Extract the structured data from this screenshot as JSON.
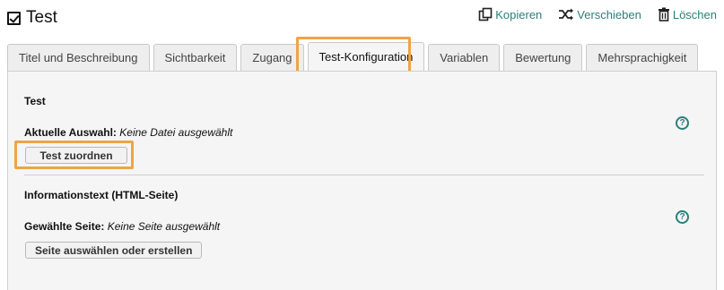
{
  "header": {
    "title": "Test",
    "actions": {
      "copy": "Kopieren",
      "move": "Verschieben",
      "delete": "Löschen"
    }
  },
  "tabs": [
    {
      "label": "Titel und Beschreibung"
    },
    {
      "label": "Sichtbarkeit"
    },
    {
      "label": "Zugang"
    },
    {
      "label": "Test-Konfiguration",
      "active": true
    },
    {
      "label": "Variablen"
    },
    {
      "label": "Bewertung"
    },
    {
      "label": "Mehrsprachigkeit"
    }
  ],
  "test_section": {
    "title": "Test",
    "selection_label": "Aktuelle Auswahl:",
    "selection_value": "Keine Datei ausgewählt",
    "button": "Test zuordnen",
    "help_glyph": "?"
  },
  "info_section": {
    "title": "Informationstext (HTML-Seite)",
    "selection_label": "Gewählte Seite:",
    "selection_value": "Keine Seite ausgewählt",
    "button": "Seite auswählen oder erstellen",
    "help_glyph": "?"
  },
  "colors": {
    "accent": "#2a7f7a",
    "highlight": "#eea446"
  }
}
